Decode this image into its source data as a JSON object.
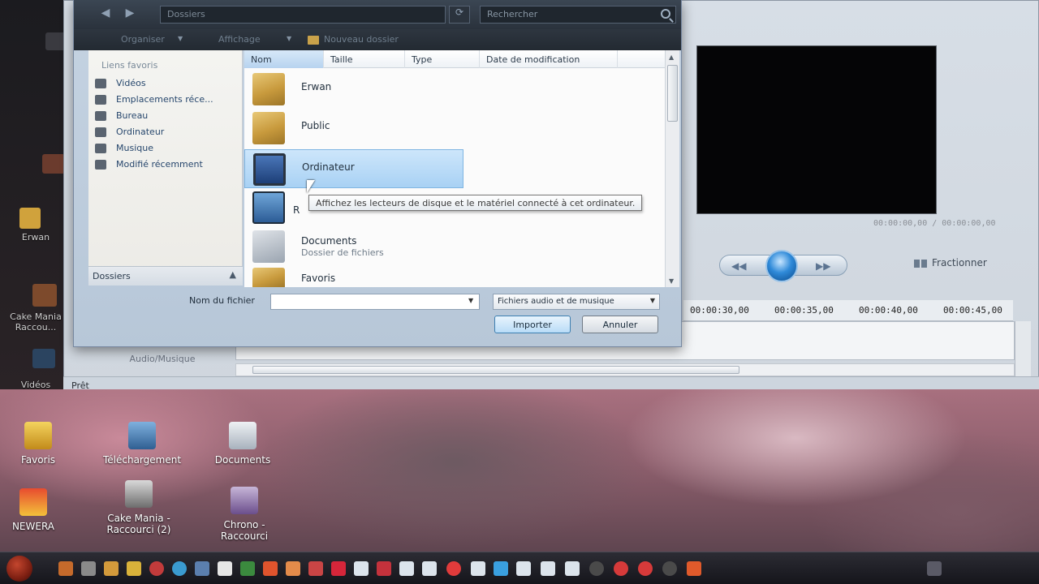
{
  "dialog": {
    "path": "Dossiers",
    "search_placeholder": "Rechercher",
    "toolbar": {
      "organize": "Organiser",
      "views": "Affichage",
      "new_folder": "Nouveau dossier"
    },
    "favorites_header": "Liens favoris",
    "nav_items": [
      {
        "label": "Vidéos",
        "icon": "video-icon"
      },
      {
        "label": "Emplacements réce...",
        "icon": "recent-places-icon"
      },
      {
        "label": "Bureau",
        "icon": "desktop-icon"
      },
      {
        "label": "Ordinateur",
        "icon": "computer-icon"
      },
      {
        "label": "Musique",
        "icon": "music-icon"
      },
      {
        "label": "Modifié récemment",
        "icon": "recently-changed-icon"
      }
    ],
    "folders_label": "Dossiers",
    "columns": [
      "Nom",
      "Taille",
      "Type",
      "Date de modification"
    ],
    "files": [
      {
        "name": "Erwan",
        "subtitle": "",
        "icon": "user-folder-icon"
      },
      {
        "name": "Public",
        "subtitle": "",
        "icon": "folder-icon"
      },
      {
        "name": "Ordinateur",
        "subtitle": "",
        "icon": "computer-icon",
        "selected": true
      },
      {
        "name": "R",
        "subtitle": "",
        "icon": "network-icon"
      },
      {
        "name": "Documents",
        "subtitle": "Dossier de fichiers",
        "icon": "documents-icon"
      },
      {
        "name": "Favoris",
        "subtitle": "",
        "icon": "favorites-folder-icon"
      }
    ],
    "tooltip": "Affichez les lecteurs de disque et le matériel connecté à cet ordinateur.",
    "filename_label": "Nom du fichier",
    "filename_value": "",
    "filetype_value": "Fichiers audio et de musique",
    "import_button": "Importer",
    "cancel_button": "Annuler"
  },
  "movie_maker": {
    "timecode": "00:00:00,00 / 00:00:00,00",
    "split_label": "Fractionner",
    "timeline_ticks": [
      "00:00:30,00",
      "00:00:35,00",
      "00:00:40,00",
      "00:00:45,00"
    ],
    "audio_track_label": "Audio/Musique",
    "status": "Prêt"
  },
  "desktop": {
    "icons": [
      "Favoris",
      "Téléchargement",
      "Documents",
      "NEWERA",
      "Cake Mania - Raccourci (2)",
      "Chrono - Raccourci"
    ],
    "left_strip_labels": [
      "Cake Mania Raccou...",
      "Vidéos",
      "Erwan"
    ]
  },
  "colors": {
    "selection": "#a8d1f4",
    "dialog_frame": "#b7c7d8",
    "preview_bg": "#050506",
    "taskbar": "#15151b"
  }
}
